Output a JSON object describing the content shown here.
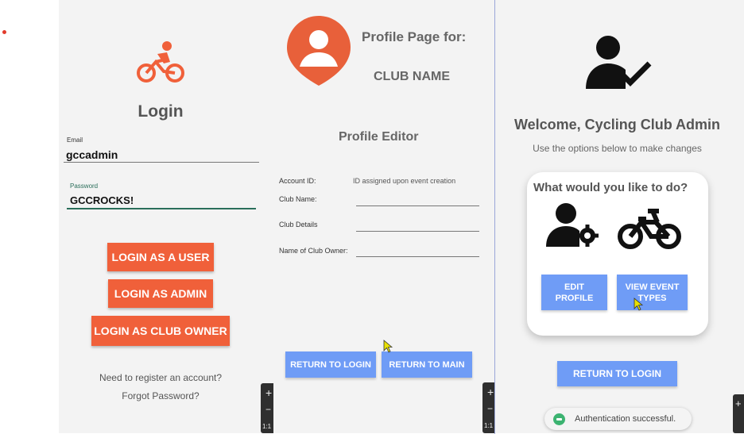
{
  "left_screen": {
    "title": "Login",
    "email_label": "Email",
    "email_value": "gccadmin",
    "password_label": "Password",
    "password_value": "GCCROCKS!",
    "login_user_btn": "LOGIN AS A USER",
    "login_admin_btn": "LOGIN AS ADMIN",
    "login_owner_btn": "LOGIN AS CLUB OWNER",
    "register_link": "Need to register an account?",
    "forgot_link": "Forgot Password?",
    "icon_color": "#f0603a"
  },
  "middle_screen": {
    "header_line1": "Profile Page for:",
    "header_line2": "CLUB NAME",
    "section_title": "Profile Editor",
    "account_id_label": "Account ID:",
    "account_id_value": "ID assigned upon event creation",
    "club_name_label": "Club Name:",
    "club_details_label": "Club Details",
    "owner_label": "Name of Club Owner:",
    "return_login_btn": "RETURN TO LOGIN",
    "return_main_btn": "RETURN TO MAIN"
  },
  "right_screen": {
    "welcome": "Welcome, Cycling Club Admin",
    "subtitle": "Use the options below to make changes",
    "card_title": "What would you like to do?",
    "edit_profile_btn_line1": "EDIT",
    "edit_profile_btn_line2": "PROFILE",
    "view_event_btn_line1": "VIEW EVENT",
    "view_event_btn_line2": "TYPES",
    "return_login_btn": "RETURN TO LOGIN",
    "toast": "Authentication successful."
  },
  "side_tabs": {
    "plus": "+",
    "minus": "−",
    "zoom": "1:1"
  },
  "colors": {
    "accent_orange": "#f0603a",
    "button_blue": "#6f9cf6"
  }
}
